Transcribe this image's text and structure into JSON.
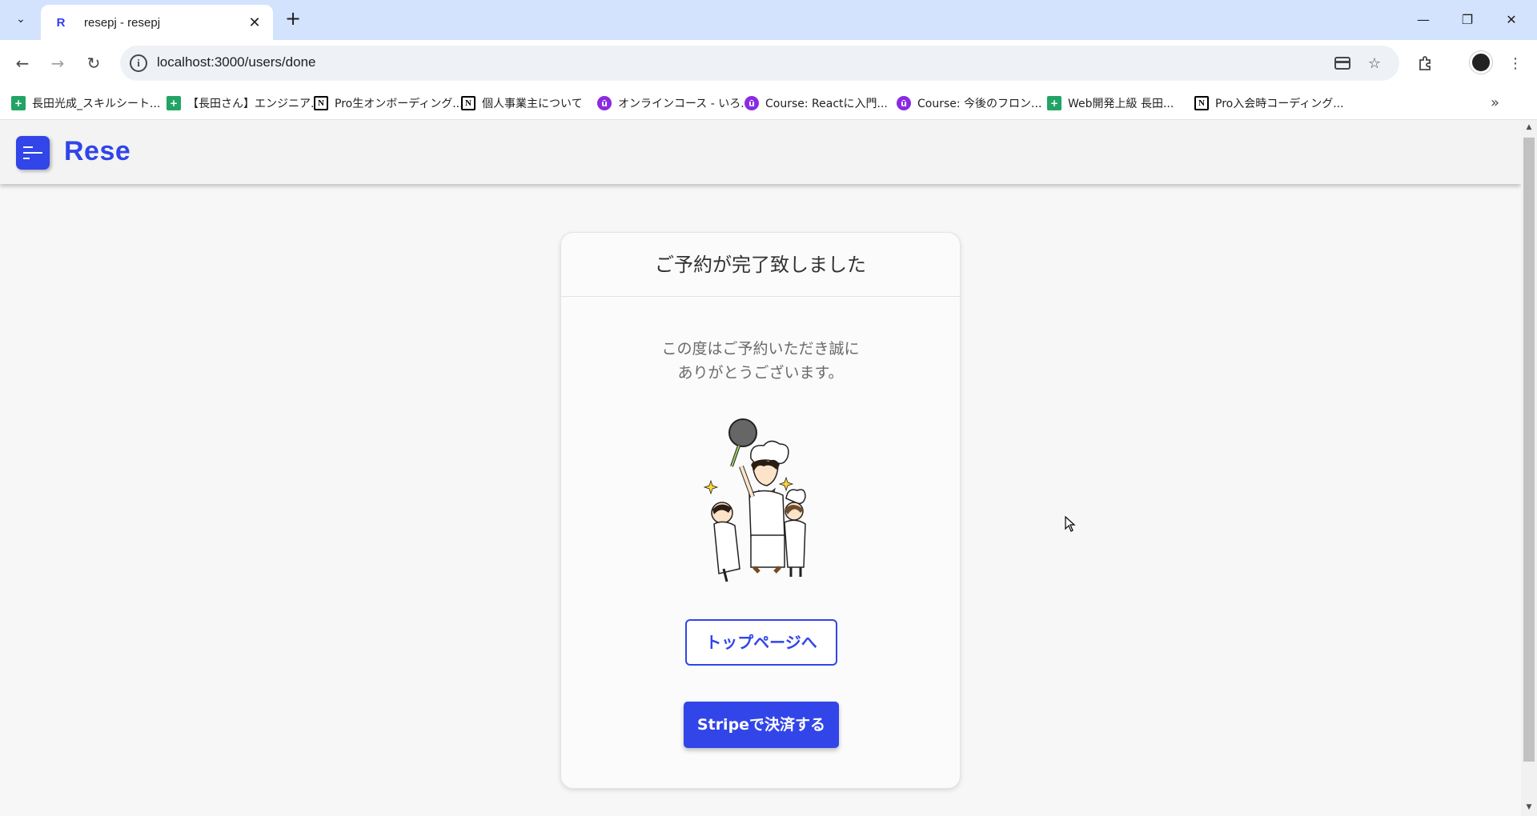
{
  "browser": {
    "tab_title": "resepj - resepj",
    "tab_favicon": "R",
    "url": "localhost:3000/users/done",
    "bookmarks": [
      {
        "label": "長田光成_スキルシート...",
        "icon": "sheets-icon"
      },
      {
        "label": "【長田さん】エンジニア...",
        "icon": "sheets-icon"
      },
      {
        "label": "Pro生オンボーディング...",
        "icon": "notion-icon"
      },
      {
        "label": "個人事業主について",
        "icon": "notion-icon"
      },
      {
        "label": "オンラインコース - いろ...",
        "icon": "udemy-icon"
      },
      {
        "label": "Course: Reactに入門...",
        "icon": "udemy-icon"
      },
      {
        "label": "Course: 今後のフロン...",
        "icon": "udemy-icon"
      },
      {
        "label": "Web開発上級 長田...",
        "icon": "sheets-icon"
      },
      {
        "label": "Pro入会時コーディング...",
        "icon": "notion-icon"
      }
    ]
  },
  "app": {
    "logo": "Rese",
    "brand_color": "#3145e8"
  },
  "card": {
    "title": "ご予約が完了致しました",
    "message_line1": "この度はご予約いただき誠に",
    "message_line2": "ありがとうございます。",
    "top_button": "トップページへ",
    "stripe_button": "Stripeで決済する"
  }
}
